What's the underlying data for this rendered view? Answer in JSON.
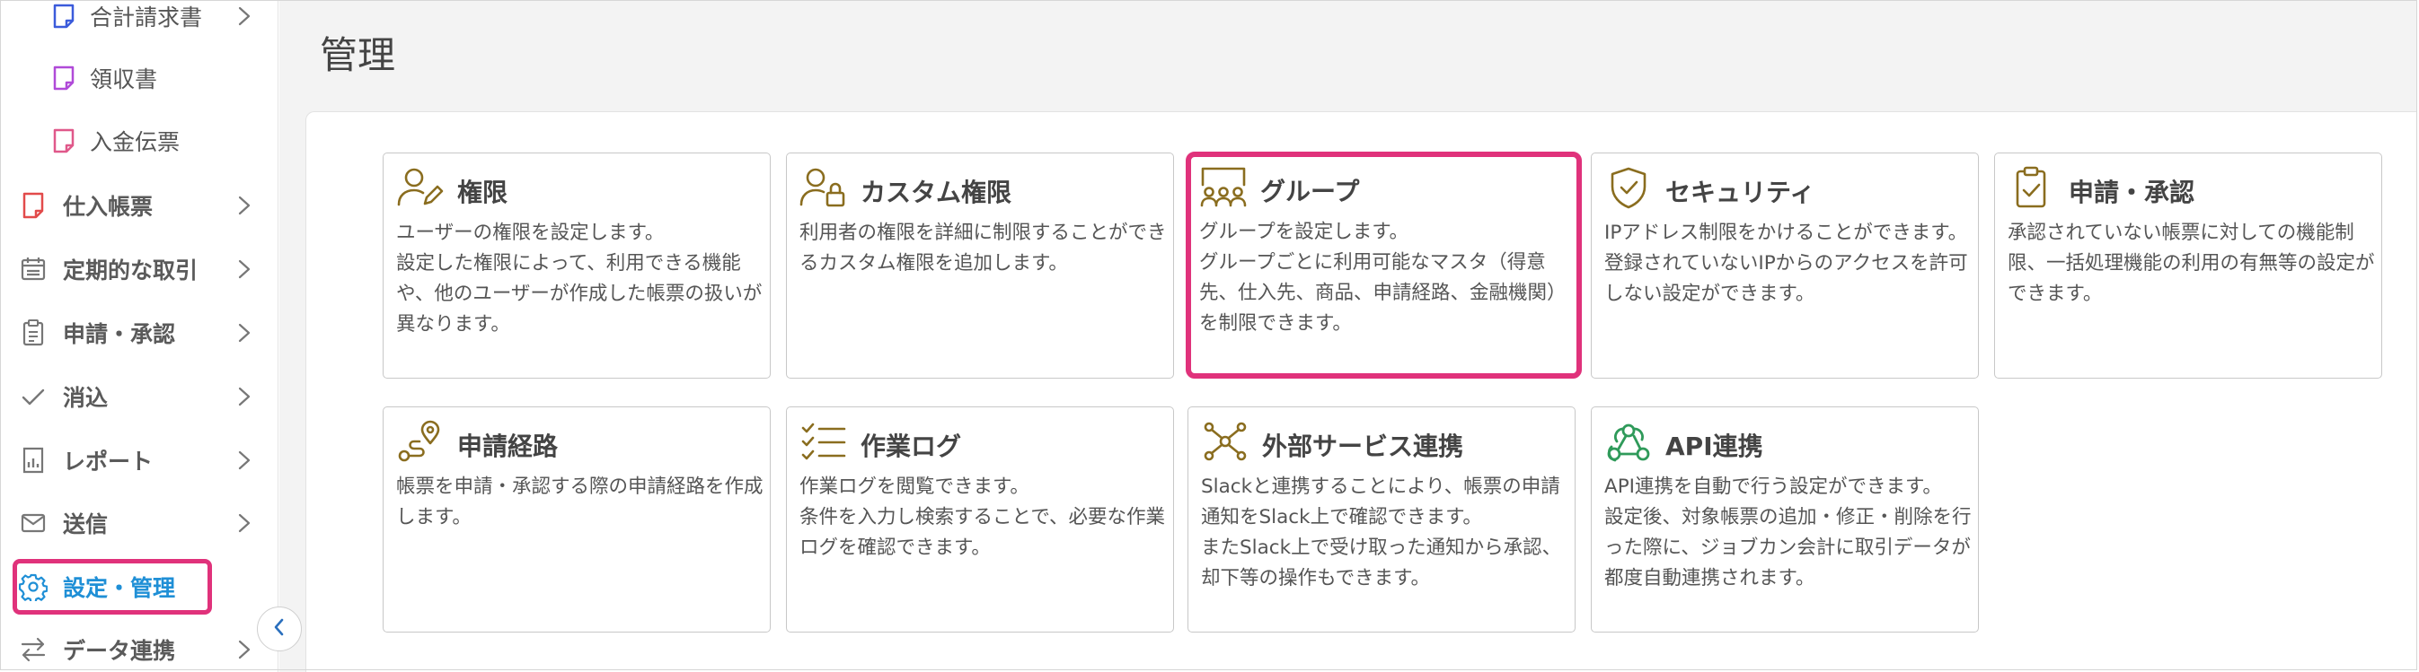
{
  "sidebar": {
    "items": [
      {
        "label": "合計請求書",
        "icon": "document-icon",
        "icon_color": "#3b5bdb"
      },
      {
        "label": "領収書",
        "icon": "document-icon",
        "icon_color": "#b04ad8"
      },
      {
        "label": "入金伝票",
        "icon": "document-icon",
        "icon_color": "#e0588a"
      },
      {
        "label": "仕入帳票",
        "icon": "document-icon",
        "icon_color": "#e24b4b"
      },
      {
        "label": "定期的な取引",
        "icon": "calendar-icon"
      },
      {
        "label": "申請・承認",
        "icon": "clipboard-icon"
      },
      {
        "label": "消込",
        "icon": "check-icon"
      },
      {
        "label": "レポート",
        "icon": "report-icon"
      },
      {
        "label": "送信",
        "icon": "mail-icon"
      },
      {
        "label": "設定・管理",
        "icon": "gear-icon",
        "active": true,
        "active_color": "#1f8fd6"
      },
      {
        "label": "データ連携",
        "icon": "exchange-icon"
      }
    ]
  },
  "main": {
    "title": "管理",
    "highlight_color": "#e0327b",
    "cards": [
      {
        "title": "権限",
        "icon": "user-edit-icon",
        "desc": [
          "ユーザーの権限を設定します。",
          "設定した権限によって、利用できる機能や、他のユーザーが作成した帳票の扱いが異なります。"
        ]
      },
      {
        "title": "カスタム権限",
        "icon": "user-lock-icon",
        "desc": [
          "利用者の権限を詳細に制限することができるカスタム権限を追加します。"
        ]
      },
      {
        "title": "グループ",
        "icon": "group-icon",
        "highlighted": true,
        "desc": [
          "グループを設定します。",
          "グループごとに利用可能なマスタ（得意先、仕入先、商品、申請経路、金融機関）を制限できます。"
        ]
      },
      {
        "title": "セキュリティ",
        "icon": "shield-check-icon",
        "desc": [
          "IPアドレス制限をかけることができます。",
          "登録されていないIPからのアクセスを許可しない設定ができます。"
        ]
      },
      {
        "title": "申請・承認",
        "icon": "clipboard-check-icon",
        "desc": [
          "承認されていない帳票に対しての機能制限、一括処理機能の利用の有無等の設定ができます。"
        ]
      },
      {
        "title": "申請経路",
        "icon": "route-icon",
        "desc": [
          "帳票を申請・承認する際の申請経路を作成します。"
        ]
      },
      {
        "title": "作業ログ",
        "icon": "checklist-icon",
        "desc": [
          "作業ログを閲覧できます。",
          "条件を入力し検索することで、必要な作業ログを確認できます。"
        ]
      },
      {
        "title": "外部サービス連携",
        "icon": "network-icon",
        "desc": [
          "Slackと連携することにより、帳票の申請通知をSlack上で確認できます。",
          "またSlack上で受け取った通知から承認、却下等の操作もできます。"
        ]
      },
      {
        "title": "API連携",
        "icon": "webhook-icon",
        "desc": [
          "API連携を自動で行う設定ができます。",
          "設定後、対象帳票の追加・修正・削除を行った際に、ジョブカン会計に取引データが都度自動連携されます。"
        ]
      }
    ]
  }
}
